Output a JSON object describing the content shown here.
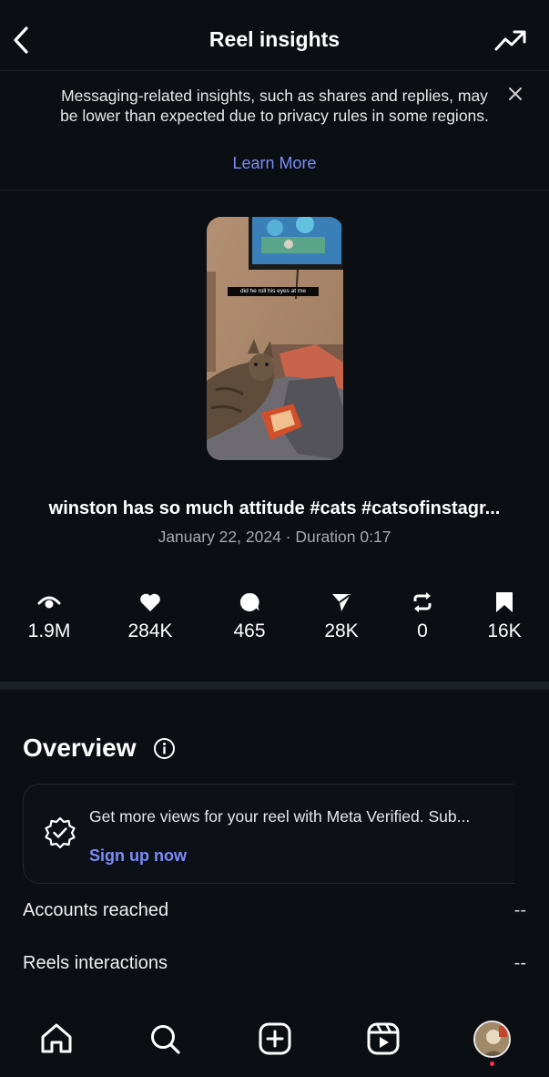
{
  "header": {
    "title": "Reel insights",
    "back_icon": "chevron-left-icon",
    "trend_icon": "trending-up-icon"
  },
  "notice": {
    "text": "Messaging-related insights, such as shares and replies, may be lower than expected due to privacy rules in some regions.",
    "link": "Learn More",
    "close_icon": "close-icon"
  },
  "reel": {
    "thumbnail_caption": "did he roll his eyes at me",
    "title": "winston has so much attitude #cats #catsofinstagr...",
    "meta": "January 22, 2024 · Duration 0:17"
  },
  "stats": [
    {
      "icon": "eye-icon",
      "value": "1.9M"
    },
    {
      "icon": "heart-icon",
      "value": "284K"
    },
    {
      "icon": "comment-icon",
      "value": "465"
    },
    {
      "icon": "share-icon",
      "value": "28K"
    },
    {
      "icon": "repost-icon",
      "value": "0"
    },
    {
      "icon": "bookmark-icon",
      "value": "16K"
    }
  ],
  "overview": {
    "title": "Overview",
    "info_icon": "info-icon",
    "promo": {
      "icon": "verified-badge-icon",
      "text": "Get more views for your reel with Meta Verified. Sub...",
      "link": "Sign up now"
    },
    "metrics": [
      {
        "label": "Accounts reached",
        "value": "--"
      },
      {
        "label": "Reels interactions",
        "value": "--"
      }
    ]
  },
  "nav": {
    "items": [
      "home-icon",
      "search-icon",
      "create-icon",
      "reels-icon",
      "profile-avatar"
    ]
  },
  "colors": {
    "background": "#0b0e13",
    "accent_link": "#7c8cf8",
    "notification_dot": "#ff3040"
  }
}
